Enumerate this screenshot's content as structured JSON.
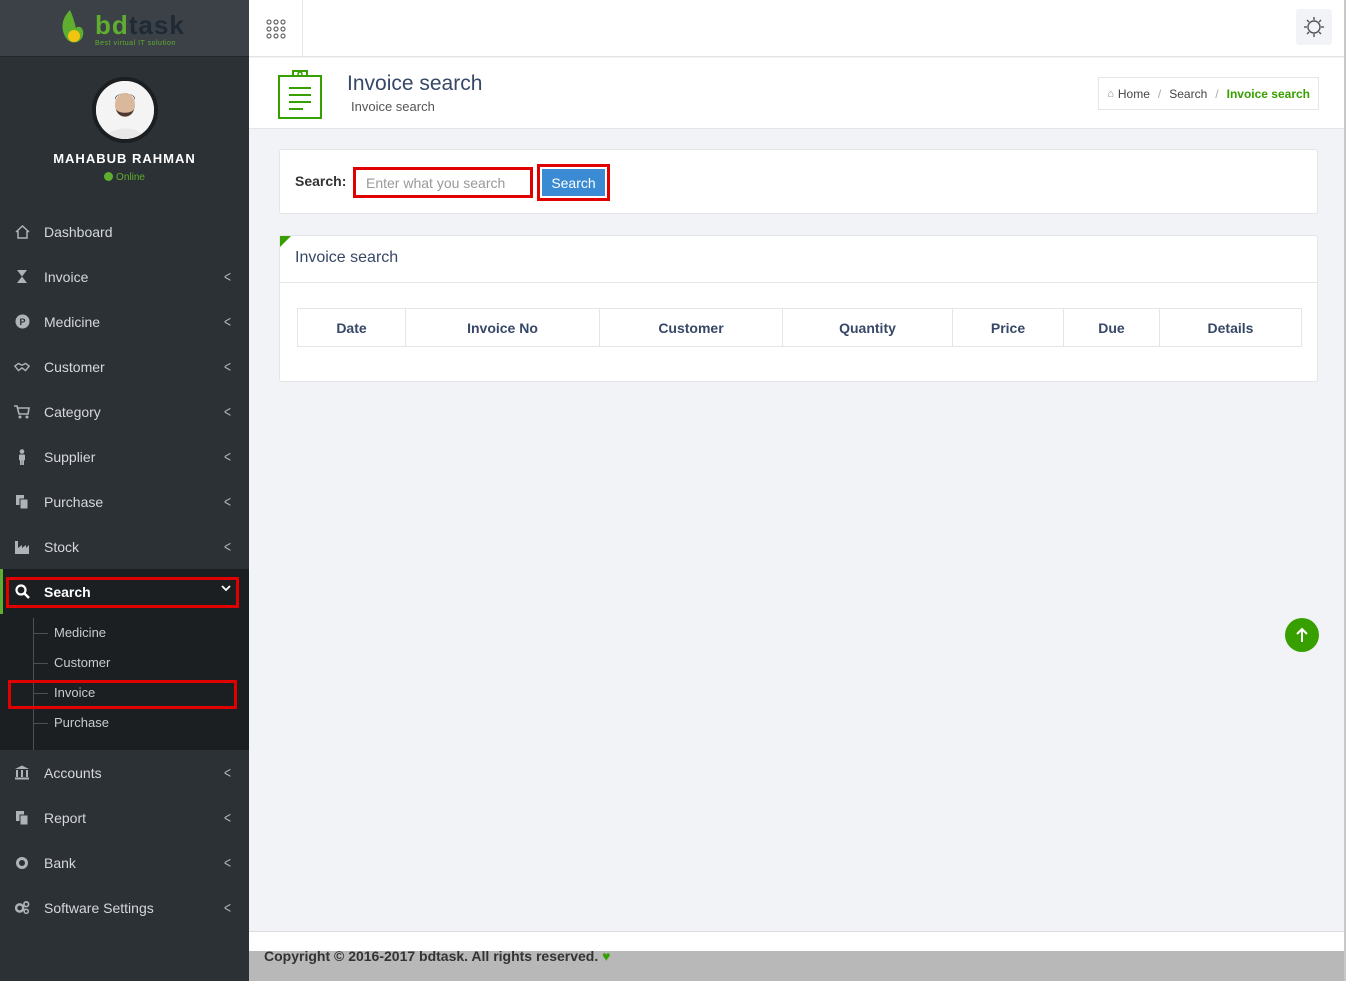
{
  "brand": {
    "name_a": "bd",
    "name_b": "task",
    "tagline": "Best virtual IT solution"
  },
  "user": {
    "name": "MAHABUB RAHMAN",
    "status": "Online"
  },
  "sidebar": {
    "items": [
      {
        "label": "Dashboard",
        "icon": "home-icon",
        "has_arrow": false
      },
      {
        "label": "Invoice",
        "icon": "hourglass-icon",
        "has_arrow": true
      },
      {
        "label": "Medicine",
        "icon": "product-icon",
        "has_arrow": true
      },
      {
        "label": "Customer",
        "icon": "handshake-icon",
        "has_arrow": true
      },
      {
        "label": "Category",
        "icon": "cart-icon",
        "has_arrow": true
      },
      {
        "label": "Supplier",
        "icon": "person-icon",
        "has_arrow": true
      },
      {
        "label": "Purchase",
        "icon": "copy-icon",
        "has_arrow": true
      },
      {
        "label": "Stock",
        "icon": "industry-icon",
        "has_arrow": true
      },
      {
        "label": "Search",
        "icon": "search-icon",
        "has_arrow": true,
        "active": true
      },
      {
        "label": "Accounts",
        "icon": "bank-icon",
        "has_arrow": true
      },
      {
        "label": "Report",
        "icon": "copy-icon",
        "has_arrow": true
      },
      {
        "label": "Bank",
        "icon": "gear-icon",
        "has_arrow": true
      },
      {
        "label": "Software Settings",
        "icon": "gears-icon",
        "has_arrow": true
      }
    ],
    "search_sub": [
      "Medicine",
      "Customer",
      "Invoice",
      "Purchase"
    ]
  },
  "header": {
    "title": "Invoice search",
    "subtitle": "Invoice search",
    "breadcrumb": [
      "Home",
      "Search",
      "Invoice search"
    ]
  },
  "search": {
    "label": "Search:",
    "placeholder": "Enter what you search",
    "value": "",
    "button": "Search"
  },
  "result": {
    "title": "Invoice search",
    "columns": [
      "Date",
      "Invoice No",
      "Customer",
      "Quantity",
      "Price",
      "Due",
      "Details"
    ],
    "rows": []
  },
  "footer": {
    "text": "Copyright © 2016-2017 bdtask. All rights reserved."
  },
  "colors": {
    "accent": "#37a000",
    "sidebar": "#2c3136",
    "primary_button": "#3a8bd4",
    "highlight": "#e00000"
  }
}
